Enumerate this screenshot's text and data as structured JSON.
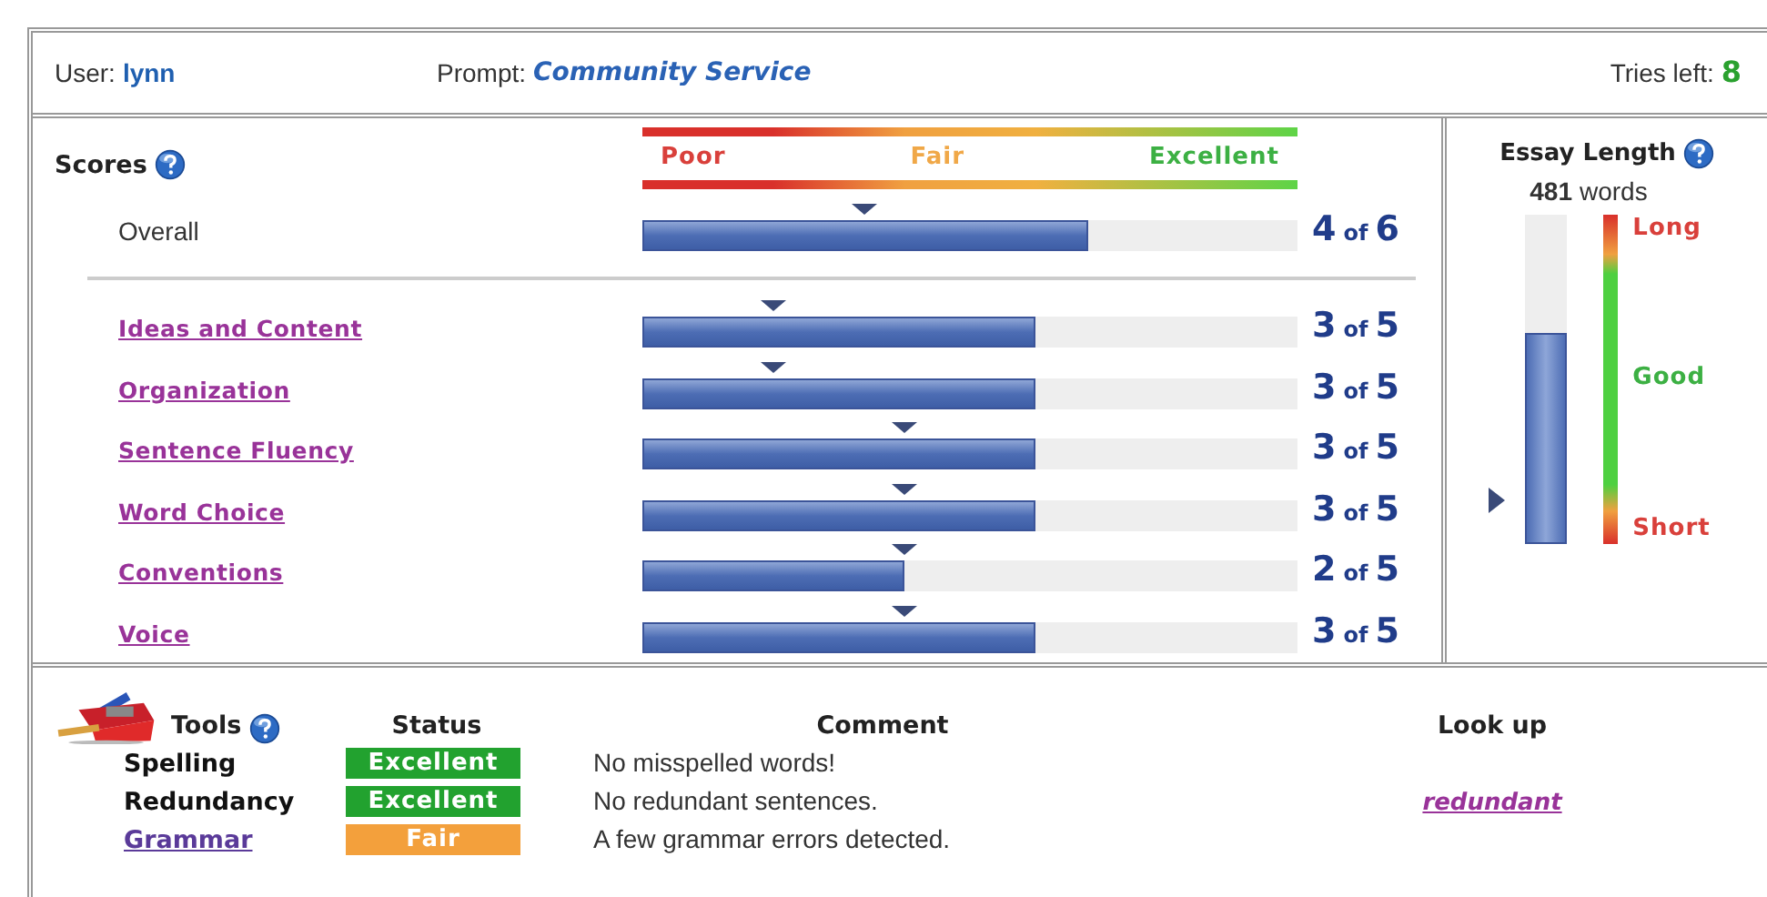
{
  "header": {
    "user_label": "User:",
    "user": "lynn",
    "prompt_label": "Prompt:",
    "prompt": "Community Service",
    "tries_label": "Tries left:",
    "tries": "8"
  },
  "scores": {
    "title": "Scores",
    "scale": [
      "Poor",
      "Fair",
      "Excellent"
    ],
    "overall": {
      "label": "Overall",
      "level": 0.68,
      "score": "4",
      "of": "of",
      "max": "6"
    },
    "traits": [
      {
        "label": "Ideas and Content",
        "level": 0.6,
        "score": "3",
        "of": "of",
        "max": "5"
      },
      {
        "label": "Organization",
        "level": 0.6,
        "score": "3",
        "of": "of",
        "max": "5"
      },
      {
        "label": "Sentence Fluency",
        "level": 0.6,
        "score": "3",
        "of": "of",
        "max": "5"
      },
      {
        "label": "Word Choice",
        "level": 0.6,
        "score": "3",
        "of": "of",
        "max": "5"
      },
      {
        "label": "Conventions",
        "level": 0.4,
        "score": "2",
        "of": "of",
        "max": "5"
      },
      {
        "label": "Voice",
        "level": 0.6,
        "score": "3",
        "of": "of",
        "max": "5"
      }
    ]
  },
  "essay_length": {
    "title": "Essay Length",
    "count": "481",
    "unit": "words",
    "level": 0.64,
    "scale": [
      "Long",
      "Good",
      "Short"
    ]
  },
  "tools": {
    "columns": [
      "Tools",
      "Status",
      "Comment",
      "Look up"
    ],
    "rows": [
      {
        "tool": "Spelling",
        "kind": "text",
        "status": "Excellent",
        "color": "#22a22f",
        "comment": "No misspelled words!"
      },
      {
        "tool": "Redundancy",
        "kind": "text",
        "status": "Excellent",
        "color": "#22a22f",
        "comment": "No redundant sentences.",
        "lookup": "redundant"
      },
      {
        "tool": "Grammar",
        "kind": "link",
        "status": "Fair",
        "color": "#f3a03c",
        "comment": "A few grammar errors detected."
      }
    ]
  }
}
